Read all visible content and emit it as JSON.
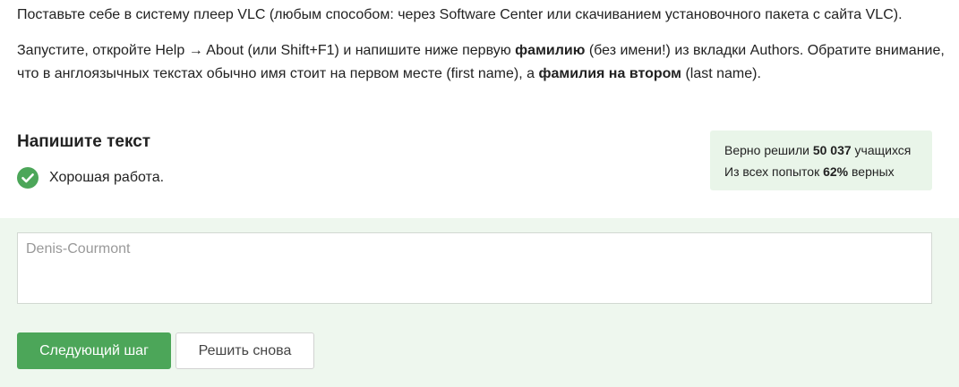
{
  "instructions": {
    "paragraph1": "Поставьте себе в систему плеер VLC (любым способом: через Software Center или скачиванием установочного пакета с сайта VLC).",
    "paragraph2": {
      "part1": "Запустите, откройте Help → About (или Shift+F1) и напишите ниже первую ",
      "bold1": "фамилию",
      "part2": " (без имени!) из вкладки Authors. Обратите внимание, что в англоязычных текстах обычно имя стоит на первом месте (first name), а ",
      "bold2": "фамилия на втором",
      "part3": " (last name)."
    }
  },
  "task": {
    "title": "Напишите текст",
    "feedback": "Хорошая работа.",
    "feedback_icon": "check-circle-icon",
    "success_color": "#4ca659"
  },
  "stats": {
    "solved_prefix": "Верно решили ",
    "solved_count": "50 037",
    "solved_suffix": " учащихся",
    "attempts_prefix": "Из всех попыток ",
    "attempts_percent": "62%",
    "attempts_suffix": " верных"
  },
  "answer": {
    "value": "Denis-Courmont"
  },
  "buttons": {
    "next_label": "Следующий шаг",
    "retry_label": "Решить снова"
  }
}
